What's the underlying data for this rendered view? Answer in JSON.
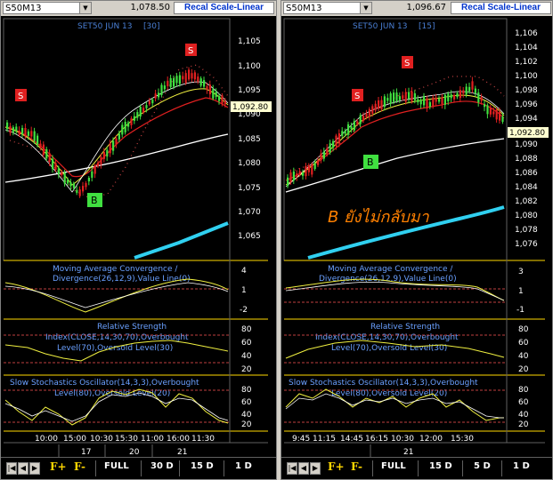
{
  "left": {
    "symbol": "S50M13",
    "last_price": "1,078.50",
    "recal_label": "Recal Scale-Linear",
    "chart_title": "SET50 JUN 13",
    "interval": "[30]",
    "price_ticks": [
      "1,105",
      "1,100",
      "1,095",
      "1,090",
      "1,085",
      "1,080",
      "1,075",
      "1,070",
      "1,065"
    ],
    "price_tag": "1,092.80",
    "signals": {
      "sell": "S",
      "buy": "B"
    },
    "macd_title": [
      "Moving Average Convergence /",
      "Divergence(26,12,9),Value Line(0)"
    ],
    "macd_ticks": [
      "4",
      "1",
      "-2"
    ],
    "rsi_title": [
      "Relative Strength",
      "Index(CLOSE,14,30,70),Overbought",
      "Level(70),Oversold Level(30)"
    ],
    "rsi_ticks": [
      "80",
      "60",
      "40",
      "20"
    ],
    "sto_title": [
      "Slow Stochastics Oscillator(14,3,3),Overbought",
      "Level(80),Oversold Level(20)"
    ],
    "sto_ticks": [
      "80",
      "60",
      "40",
      "20"
    ],
    "time_labels": [
      "10:00",
      "15:00",
      "10:30",
      "15:30",
      "11:00",
      "16:00",
      "11:30"
    ],
    "day_labels": [
      "17",
      "20",
      "21"
    ],
    "buttons": {
      "f_plus": "F+",
      "f_minus": "F-",
      "full": "FULL",
      "r1": "30 D",
      "r2": "15 D",
      "r3": "1 D"
    }
  },
  "right": {
    "symbol": "S50M13",
    "last_price": "1,096.67",
    "recal_label": "Recal Scale-Linear",
    "chart_title": "SET50 JUN 13",
    "interval": "[15]",
    "price_ticks": [
      "1,106",
      "1,104",
      "1,102",
      "1,100",
      "1,098",
      "1,096",
      "1,094",
      "1,092",
      "1,090",
      "1,088",
      "1,086",
      "1,084",
      "1,082",
      "1,080",
      "1,078",
      "1,076"
    ],
    "price_tag": "1,092.80",
    "annotation": "B ยังไม่กลับมา",
    "signals": {
      "sell": "S",
      "buy": "B"
    },
    "macd_title": [
      "Moving Average Convergence /",
      "Divergence(26,12,9),Value Line(0)"
    ],
    "macd_ticks": [
      "3",
      "1",
      "-1"
    ],
    "rsi_title": [
      "Relative Strength",
      "Index(CLOSE,14,30,70),Overbought",
      "Level(70),Oversold Level(30)"
    ],
    "rsi_ticks": [
      "80",
      "60",
      "40",
      "20"
    ],
    "sto_title": [
      "Slow Stochastics Oscillator(14,3,3),Overbought",
      "Level(80),Oversold Level(20)"
    ],
    "sto_ticks": [
      "80",
      "60",
      "40",
      "20"
    ],
    "time_labels": [
      "9:45",
      "11:15",
      "14:45",
      "16:15",
      "10:30",
      "12:00",
      "15:30"
    ],
    "day_labels": [
      "21"
    ],
    "buttons": {
      "f_plus": "F+",
      "f_minus": "F-",
      "full": "FULL",
      "r1": "15 D",
      "r2": "5 D",
      "r3": "1 D"
    }
  },
  "colors": {
    "title_blue": "#4a7fd4",
    "sell_red": "#e02020",
    "buy_green": "#40e040",
    "ma_cyan": "#30d0f0",
    "annotation": "#ff8000",
    "panel_title": "#6aa0ff"
  }
}
